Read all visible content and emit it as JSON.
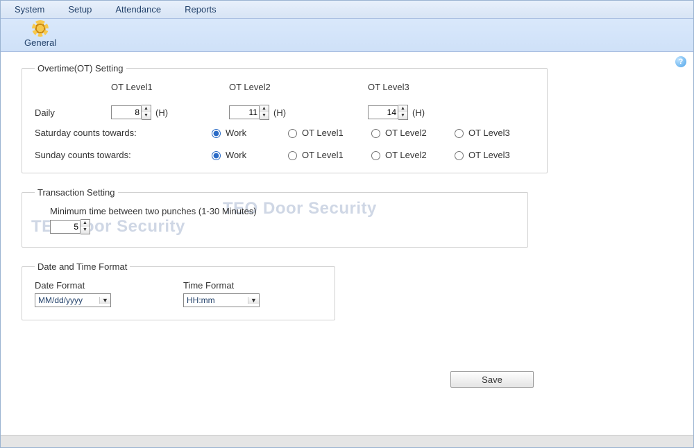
{
  "menubar": {
    "items": [
      "System",
      "Setup",
      "Attendance",
      "Reports"
    ]
  },
  "ribbon": {
    "general_label": "General"
  },
  "help_icon_glyph": "?",
  "overtime": {
    "legend": "Overtime(OT) Setting",
    "col_labels": {
      "l1": "OT Level1",
      "l2": "OT Level2",
      "l3": "OT Level3"
    },
    "daily_label": "Daily",
    "unit": "(H)",
    "values": {
      "l1": "8",
      "l2": "11",
      "l3": "14"
    },
    "saturday_label": "Saturday counts towards:",
    "sunday_label": "Sunday counts towards:",
    "radio_options": {
      "work": "Work",
      "l1": "OT Level1",
      "l2": "OT Level2",
      "l3": "OT Level3"
    },
    "saturday_selected": "work",
    "sunday_selected": "work"
  },
  "transaction": {
    "legend": "Transaction Setting",
    "min_time_label": "Minimum time between two punches (1-30 Minutes)",
    "min_time_value": "5"
  },
  "datetime": {
    "legend": "Date and Time Format",
    "date_label": "Date Format",
    "time_label": "Time Format",
    "date_value": "MM/dd/yyyy",
    "time_value": "HH:mm"
  },
  "watermark_text": "TEO Door Security",
  "save_label": "Save"
}
